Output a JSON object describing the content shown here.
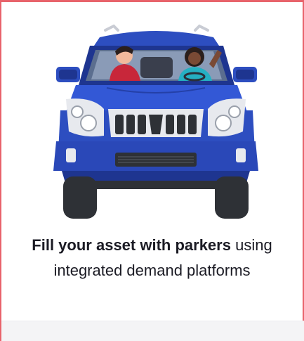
{
  "card": {
    "border_color": "#e8636b",
    "illustration_icon": "car-with-driver-and-passenger-icon"
  },
  "caption": {
    "bold_text": "Fill your asset with parkers",
    "rest_text": " using integrated demand platforms"
  },
  "colors": {
    "car_body": "#2d4ec0",
    "car_dark": "#1e3590",
    "tire": "#2e3136",
    "text": "#1b1b24"
  }
}
